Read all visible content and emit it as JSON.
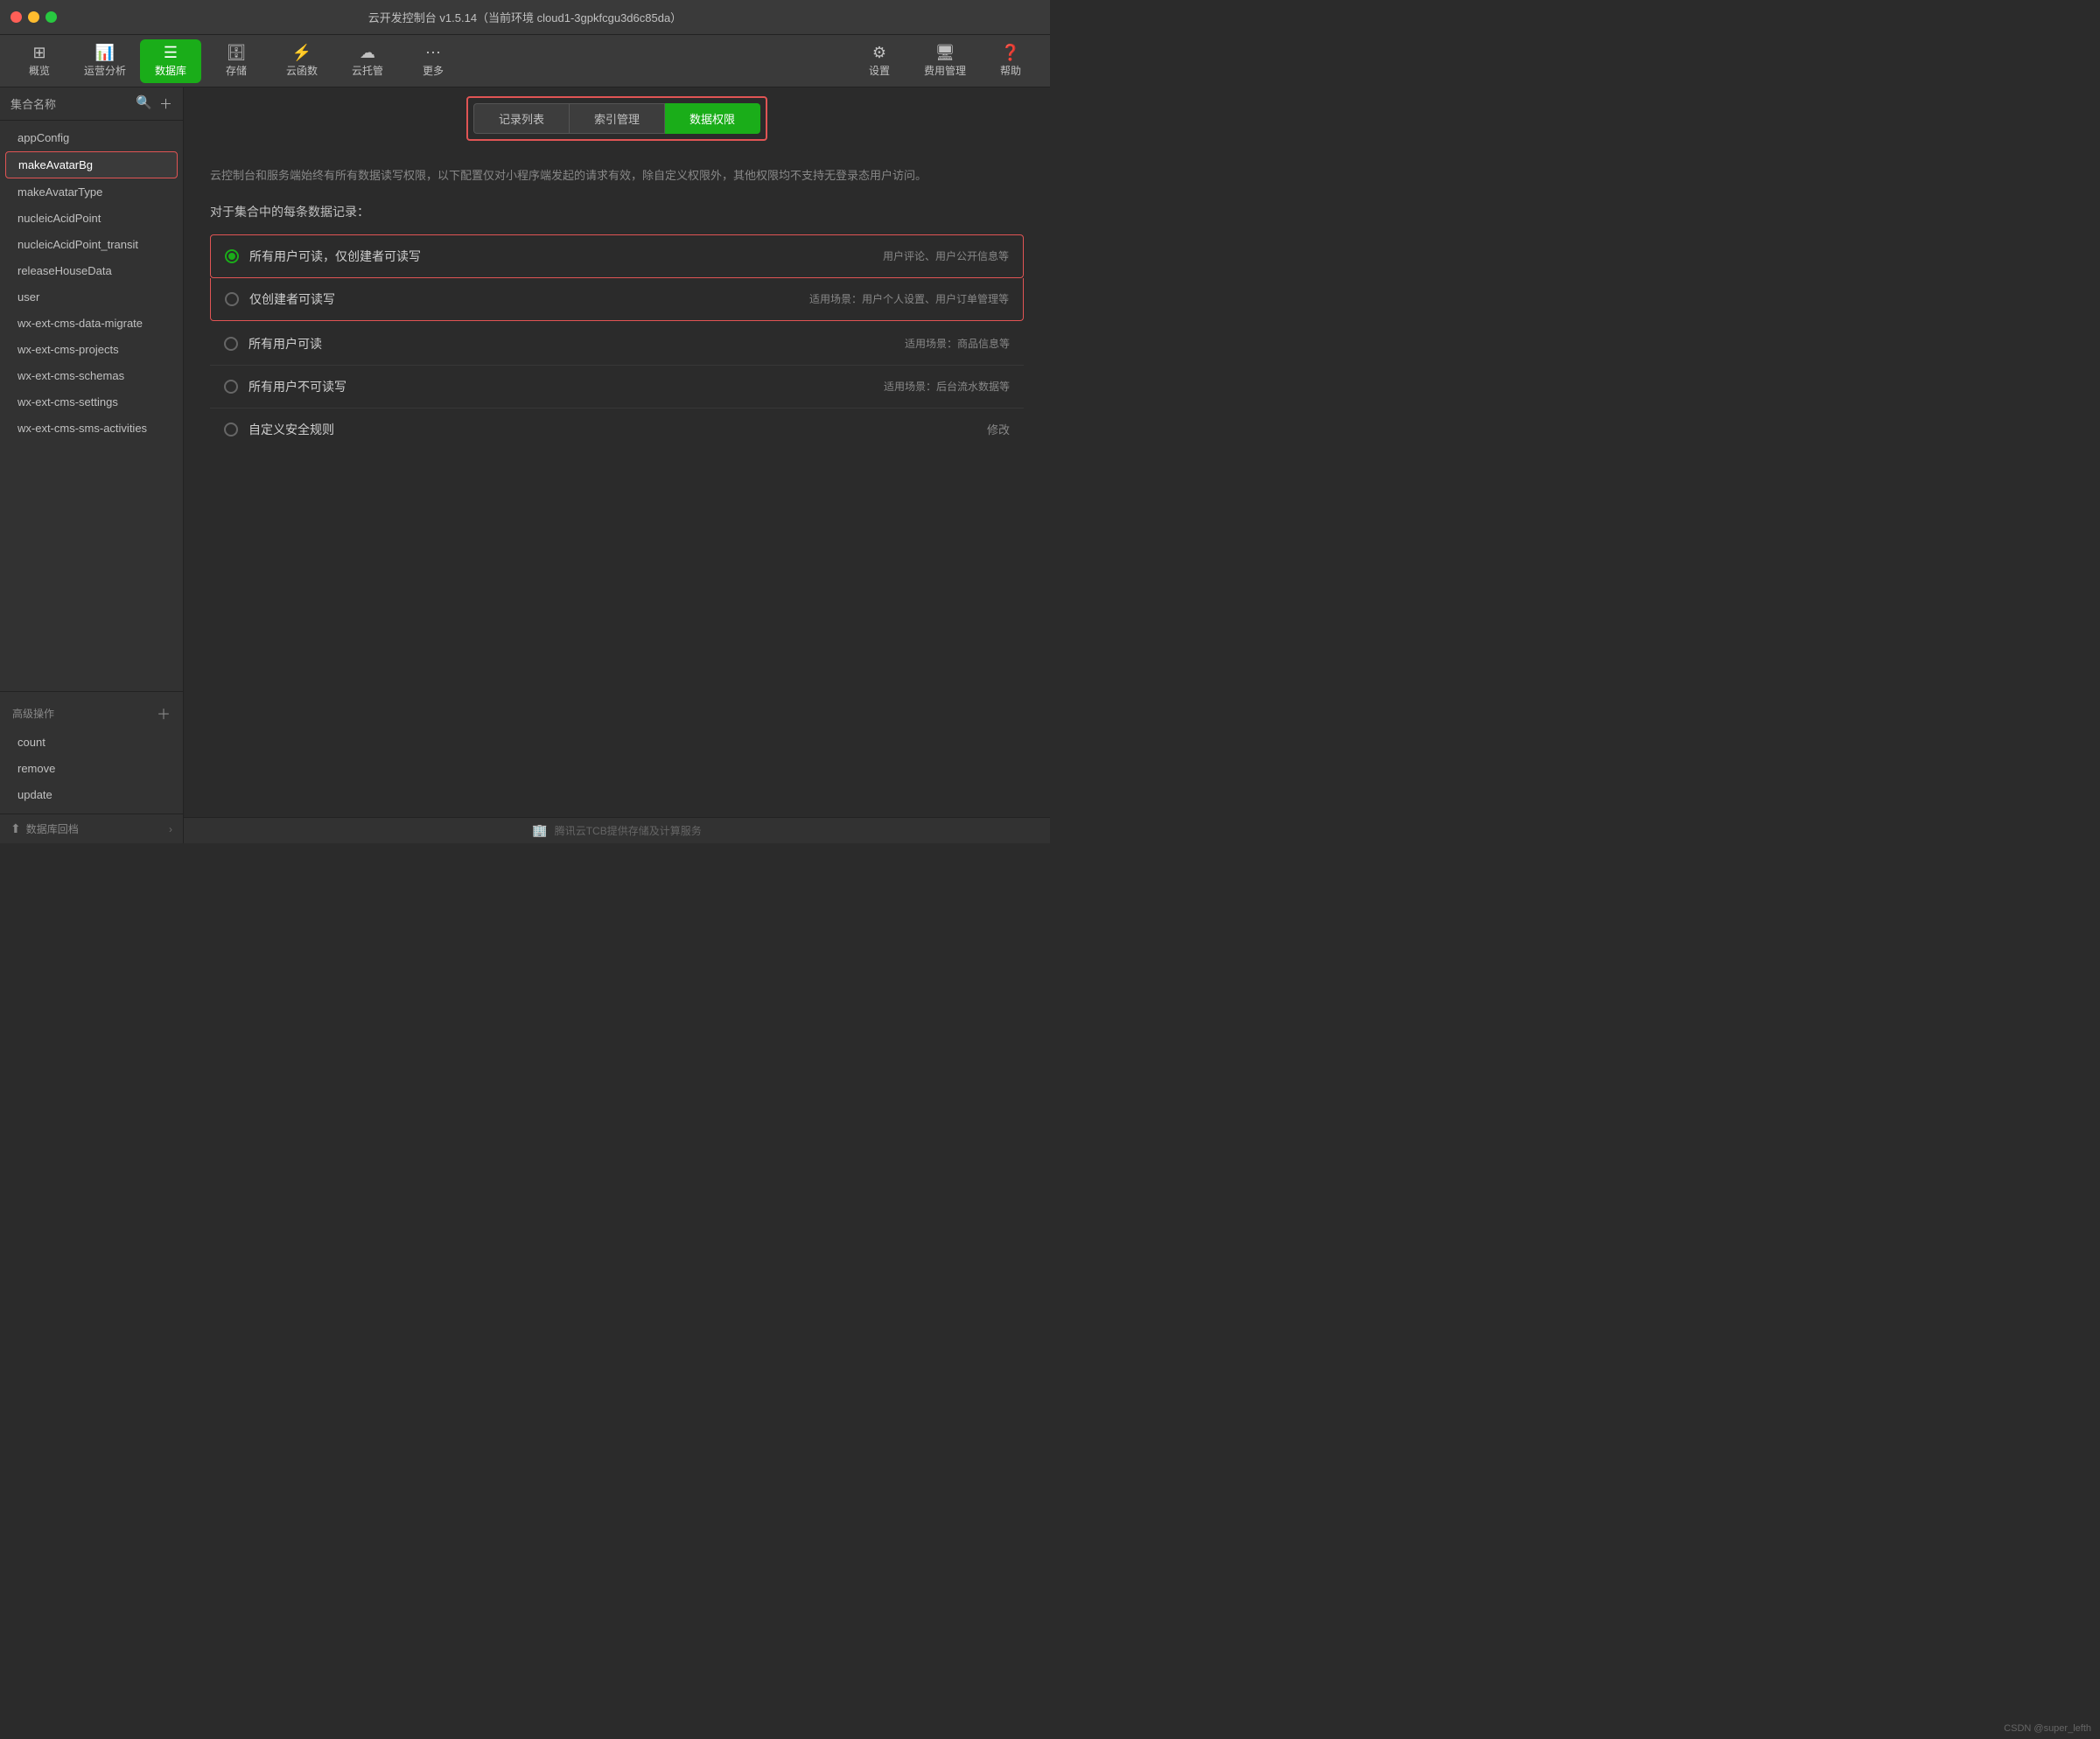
{
  "app": {
    "title": "云开发控制台 v1.5.14（当前环境 cloud1-3gpkfcgu3d6c85da）"
  },
  "toolbar": {
    "items": [
      {
        "id": "overview",
        "icon": "⊞",
        "label": "概览",
        "active": false
      },
      {
        "id": "analytics",
        "icon": "📊",
        "label": "运营分析",
        "active": false
      },
      {
        "id": "database",
        "icon": "☰",
        "label": "数据库",
        "active": true
      },
      {
        "id": "storage",
        "icon": "🗄",
        "label": "存储",
        "active": false
      },
      {
        "id": "cloudfunc",
        "icon": "⚡",
        "label": "云函数",
        "active": false
      },
      {
        "id": "cloudhosting",
        "icon": "☁",
        "label": "云托管",
        "active": false
      },
      {
        "id": "more",
        "icon": "⋯",
        "label": "更多",
        "active": false
      }
    ],
    "right_items": [
      {
        "id": "settings",
        "icon": "⚙",
        "label": "设置"
      },
      {
        "id": "billing",
        "icon": "🖥",
        "label": "费用管理"
      },
      {
        "id": "help",
        "icon": "❓",
        "label": "帮助"
      }
    ]
  },
  "sidebar": {
    "header_title": "集合名称",
    "collections": [
      {
        "id": "appConfig",
        "label": "appConfig",
        "active": false
      },
      {
        "id": "makeAvatarBg",
        "label": "makeAvatarBg",
        "active": true
      },
      {
        "id": "makeAvatarType",
        "label": "makeAvatarType",
        "active": false
      },
      {
        "id": "nucleicAcidPoint",
        "label": "nucleicAcidPoint",
        "active": false
      },
      {
        "id": "nucleicAcidPoint_transit",
        "label": "nucleicAcidPoint_transit",
        "active": false
      },
      {
        "id": "releaseHouseData",
        "label": "releaseHouseData",
        "active": false
      },
      {
        "id": "user",
        "label": "user",
        "active": false
      },
      {
        "id": "wx-ext-cms-data-migrate",
        "label": "wx-ext-cms-data-migrate",
        "active": false
      },
      {
        "id": "wx-ext-cms-projects",
        "label": "wx-ext-cms-projects",
        "active": false
      },
      {
        "id": "wx-ext-cms-schemas",
        "label": "wx-ext-cms-schemas",
        "active": false
      },
      {
        "id": "wx-ext-cms-settings",
        "label": "wx-ext-cms-settings",
        "active": false
      },
      {
        "id": "wx-ext-cms-sms-activities",
        "label": "wx-ext-cms-sms-activities",
        "active": false
      }
    ],
    "advanced_section": {
      "title": "高级操作",
      "items": [
        {
          "id": "count",
          "label": "count"
        },
        {
          "id": "remove",
          "label": "remove"
        },
        {
          "id": "update",
          "label": "update"
        }
      ]
    },
    "footer": {
      "text": "数据库回档",
      "icon": "⬆"
    }
  },
  "tabs": [
    {
      "id": "record-list",
      "label": "记录列表",
      "active": false
    },
    {
      "id": "index-management",
      "label": "索引管理",
      "active": false
    },
    {
      "id": "data-permission",
      "label": "数据权限",
      "active": true
    }
  ],
  "content": {
    "info_text": "云控制台和服务端始终有所有数据读写权限，以下配置仅对小程序端发起的请求有效，除自定义权限外，其他权限均不支持无登录态用户访问。",
    "section_label": "对于集合中的每条数据记录：",
    "permissions": [
      {
        "id": "all-read-creator-write",
        "label": "所有用户可读，仅创建者可读写",
        "hint": "用户评论、用户公开信息等",
        "selected": true,
        "highlighted": true
      },
      {
        "id": "creator-only",
        "label": "仅创建者可读写",
        "hint": "适用场景：用户个人设置、用户订单管理等",
        "selected": false,
        "highlighted": true
      },
      {
        "id": "all-read",
        "label": "所有用户可读",
        "hint": "适用场景：商品信息等",
        "selected": false,
        "highlighted": false
      },
      {
        "id": "none",
        "label": "所有用户不可读写",
        "hint": "适用场景：后台流水数据等",
        "selected": false,
        "highlighted": false
      },
      {
        "id": "custom",
        "label": "自定义安全规则",
        "hint": "",
        "modify_label": "修改",
        "selected": false,
        "highlighted": false
      }
    ]
  },
  "footer": {
    "text": "腾讯云TCB提供存储及计算服务"
  },
  "watermark": {
    "text": "CSDN @super_lefth"
  }
}
